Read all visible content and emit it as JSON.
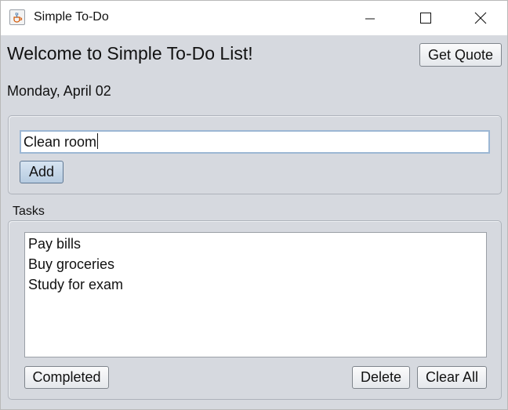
{
  "window": {
    "title": "Simple To-Do",
    "icon": "java-cup-icon",
    "controls": [
      "minimize-icon",
      "maximize-icon",
      "close-icon"
    ]
  },
  "header": {
    "welcome": "Welcome to Simple To-Do List!",
    "quote_button": "Get Quote",
    "date": "Monday, April 02"
  },
  "input_panel": {
    "task_value": "Clean room",
    "add_button": "Add"
  },
  "tasks_panel": {
    "title": "Tasks",
    "items": [
      "Pay bills",
      "Buy groceries",
      "Study for exam"
    ],
    "completed_button": "Completed",
    "delete_button": "Delete",
    "clear_button": "Clear All"
  },
  "colors": {
    "window_background": "#d6d9df",
    "titlebar": "#ffffff",
    "focus_border": "#9cb7d4",
    "default_button": "#b6cbe0"
  }
}
